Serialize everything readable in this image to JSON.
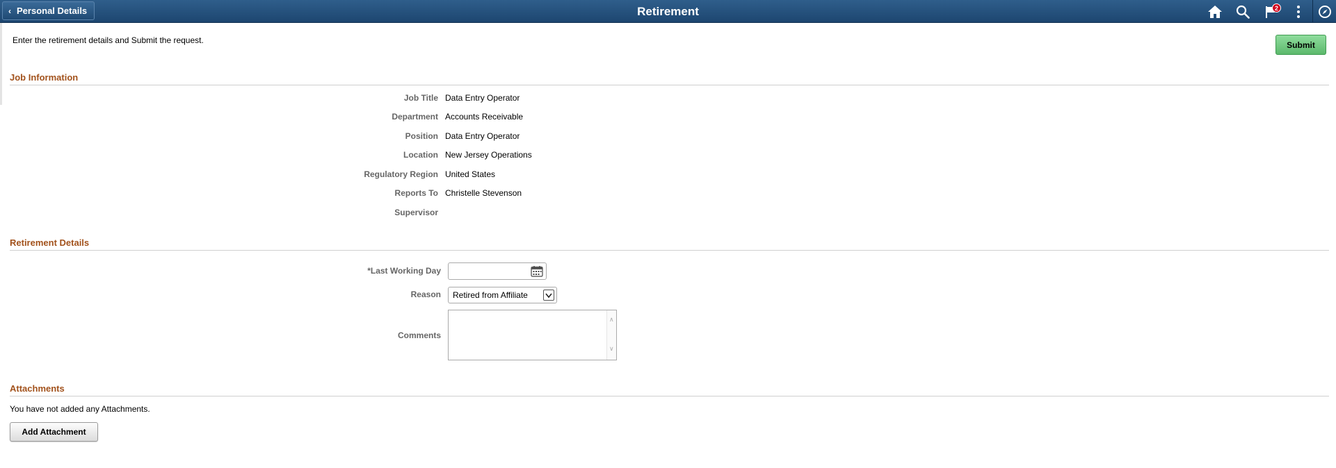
{
  "header": {
    "back_label": "Personal Details",
    "title": "Retirement",
    "notification_count": "2",
    "icons": [
      "home-icon",
      "search-icon",
      "notifications-icon",
      "actions-menu-icon",
      "navbar-icon"
    ]
  },
  "instructions": "Enter the retirement details and Submit the request.",
  "submit_label": "Submit",
  "job_information": {
    "title": "Job Information",
    "rows": [
      {
        "label": "Job Title",
        "value": "Data Entry Operator"
      },
      {
        "label": "Department",
        "value": "Accounts Receivable"
      },
      {
        "label": "Position",
        "value": "Data Entry Operator"
      },
      {
        "label": "Location",
        "value": "New Jersey Operations"
      },
      {
        "label": "Regulatory Region",
        "value": "United States"
      },
      {
        "label": "Reports To",
        "value": "Christelle Stevenson"
      },
      {
        "label": "Supervisor",
        "value": ""
      }
    ]
  },
  "retirement_details": {
    "title": "Retirement Details",
    "last_working_day_label": "*Last Working Day",
    "last_working_day_value": "",
    "reason_label": "Reason",
    "reason_value": "Retired from Affiliate",
    "comments_label": "Comments",
    "comments_value": ""
  },
  "attachments": {
    "title": "Attachments",
    "note": "You have not added any Attachments.",
    "add_label": "Add Attachment"
  },
  "colors": {
    "header": "#1d4670",
    "section_title": "#a2521c",
    "submit": "#5cb96c",
    "badge": "#d0021b"
  }
}
